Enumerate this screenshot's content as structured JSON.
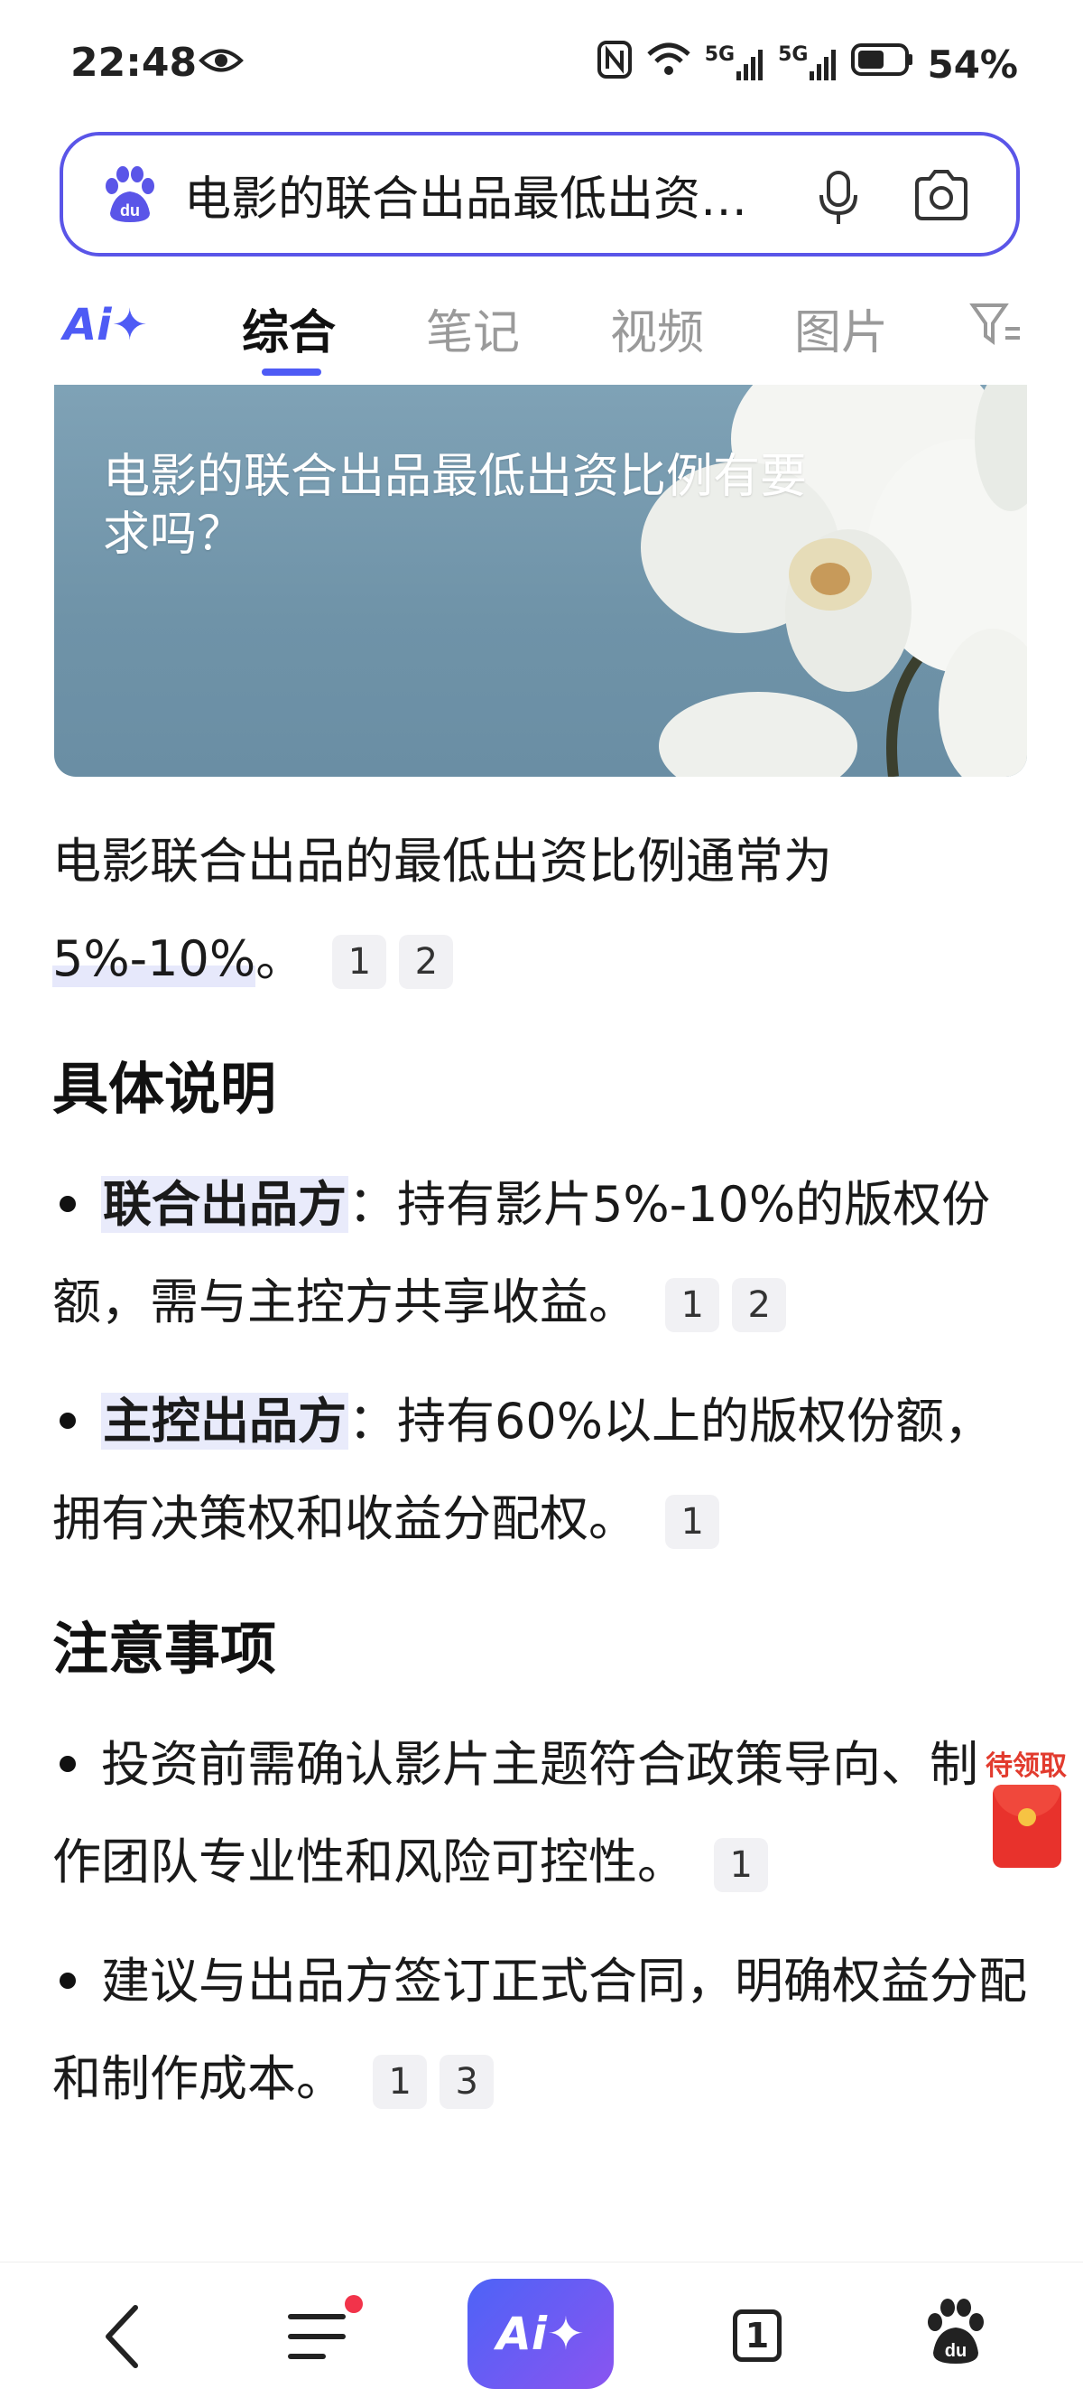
{
  "status_bar": {
    "time": "22:48",
    "network_1": "5G",
    "network_2": "5G",
    "battery": "54%"
  },
  "search": {
    "query": "电影的联合出品最低出资比例有要求吗？",
    "icons": [
      "baidu-paw-icon",
      "microphone-icon",
      "camera-icon"
    ]
  },
  "tabs": {
    "ai": "Ai✦",
    "items": [
      "综合",
      "笔记",
      "视频",
      "图片"
    ],
    "active": "综合"
  },
  "hero": {
    "text": "电影的联合出品最低出资比例有要求吗？"
  },
  "answer": {
    "intro_prefix": "电影联合出品的最低出资比例通常为",
    "intro_highlight": "5%-10%",
    "intro_suffix": "。",
    "intro_cites": [
      "1",
      "2"
    ],
    "section1": {
      "heading": "具体说明",
      "items": [
        {
          "key": "联合出品方",
          "text": "：持有影片5%-10%的版权份额，需与主控方共享收益。",
          "cites": [
            "1",
            "2"
          ]
        },
        {
          "key": "主控出品方",
          "text": "：持有60%以上的版权份额，拥有决策权和收益分配权。",
          "cites": [
            "1"
          ]
        }
      ]
    },
    "section2": {
      "heading": "注意事项",
      "items": [
        {
          "text": "投资前需确认影片主题符合政策导向、制作团队专业性和风险可控性。",
          "cites": [
            "1"
          ]
        },
        {
          "text": "建议与出品方签订正式合同，明确权益分配和制作成本。",
          "cites": [
            "1",
            "3"
          ]
        }
      ]
    }
  },
  "red_packet": {
    "label": "待领取"
  },
  "bottom_nav": {
    "ai_label": "Ai✦",
    "tab_count": "1",
    "icons": [
      "back-icon",
      "menu-icon",
      "ai-button",
      "tabs-icon",
      "baidu-home-icon"
    ]
  },
  "colors": {
    "accent": "#4e5bf5",
    "highlight": "#e9ebfb",
    "red": "#e8322c"
  }
}
